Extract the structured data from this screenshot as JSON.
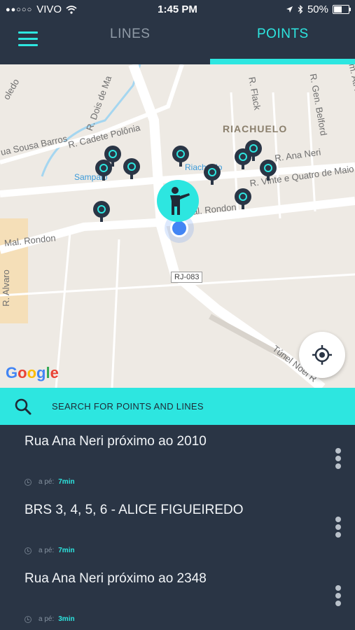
{
  "status_bar": {
    "carrier": "VIVO",
    "time": "1:45 PM",
    "battery": "50%",
    "battery_level": 0.5
  },
  "nav": {
    "tab_lines": "LINES",
    "tab_points": "POINTS",
    "active_tab": "POINTS",
    "menu_icon": "hamburger-menu-icon"
  },
  "map": {
    "labels": {
      "oledo": "oledo",
      "dois": "R. Dois de Ma",
      "sousa": "ua Sousa Barros",
      "cadete": "R. Cadete Polônia",
      "riachuelo": "RIACHUELO",
      "flack": "R. Flack",
      "belford": "R. Gen. Belford",
      "alm": "Alm. Ati Pancetas",
      "ananeri": "R. Ana Neri",
      "riachuelo_station": "Riachuelo",
      "sampaio": "Sampaio",
      "vinte": "R. Vinte e Quatro de Maio",
      "rondon1": "Mal. Rondon",
      "rondon2": "Mal. Rondon",
      "alvaro": "R. Alvaro",
      "tunel": "Túnel Noel R"
    },
    "road_sign": "RJ-083",
    "google_logo": "Google",
    "colors": {
      "map_bg": "#eeeae4",
      "road": "#ffffff",
      "park": "#f5dfb8",
      "water": "#a5d6f0"
    }
  },
  "search": {
    "placeholder": "SEARCH FOR POINTS AND LINES",
    "icon": "search-icon"
  },
  "points": [
    {
      "name": "Rua Ana Neri próximo ao 2010",
      "walk_label": "a pé:",
      "walk_time": "7min"
    },
    {
      "name": "BRS 3, 4, 5, 6 - ALICE FIGUEIREDO",
      "walk_label": "a pé:",
      "walk_time": "7min"
    },
    {
      "name": "Rua Ana Neri próximo ao 2348",
      "walk_label": "a pé:",
      "walk_time": "3min"
    }
  ],
  "colors": {
    "accent": "#2de6e0",
    "navy": "#2a3545",
    "text": "#f2f5f8"
  }
}
